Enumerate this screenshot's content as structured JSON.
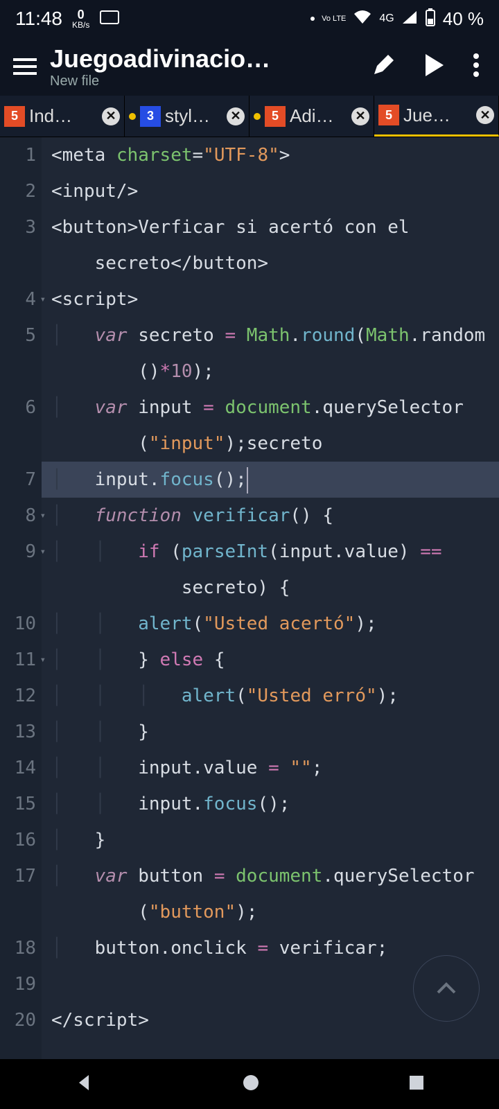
{
  "status": {
    "time": "11:48",
    "data_n": "0",
    "data_unit": "KB/s",
    "net": "4G",
    "battery": "40 %",
    "volte": "Vo LTE"
  },
  "toolbar": {
    "title": "Juegoadivinacio…",
    "subtitle": "New file"
  },
  "tabs": [
    {
      "type": "html",
      "badge": "5",
      "label": "Ind…",
      "modified": false
    },
    {
      "type": "css",
      "badge": "3",
      "label": "styl…",
      "modified": true
    },
    {
      "type": "html",
      "badge": "5",
      "label": "Adi…",
      "modified": true
    },
    {
      "type": "html",
      "badge": "5",
      "label": "Jue…",
      "modified": false,
      "active": true
    }
  ],
  "code_lines": [
    {
      "n": 1,
      "html": "<span class='t-tag'>&lt;meta</span> <span class='t-attr'>charset</span><span class='t-tag'>=</span><span class='t-str'>\"UTF-8\"</span><span class='t-tag'>&gt;</span>"
    },
    {
      "n": 2,
      "html": "<span class='t-tag'>&lt;input/&gt;</span>"
    },
    {
      "n": 3,
      "wrap": true,
      "html": "<span class='t-tag'>&lt;button&gt;</span>Verficar si acertó con el\n    secreto<span class='t-tag'>&lt;/button&gt;</span>"
    },
    {
      "n": 4,
      "fold": true,
      "html": "<span class='t-tag'>&lt;script&gt;</span>"
    },
    {
      "n": 5,
      "wrap": true,
      "html": "<span class='guide'>│   </span><span class='t-kw'>var</span> secreto <span class='t-op'>=</span> <span class='t-obj'>Math</span>.<span class='t-fn'>round</span>(<span class='t-obj'>Math</span>.random\n        ()<span class='t-op'>*</span><span class='t-num'>10</span>);"
    },
    {
      "n": 6,
      "wrap": true,
      "html": "<span class='guide'>│   </span><span class='t-kw'>var</span> input <span class='t-op'>=</span> <span class='t-obj'>document</span>.querySelector\n        (<span class='t-str'>\"input\"</span>);secreto"
    },
    {
      "n": 7,
      "hl": true,
      "html": "<span class='guide'>│   </span>input.<span class='t-fn'>focus</span>();<span class='cursor'></span>"
    },
    {
      "n": 8,
      "fold": true,
      "html": "<span class='guide'>│   </span><span class='t-kw'>function</span> <span class='t-name'>verificar</span>() {"
    },
    {
      "n": 9,
      "fold": true,
      "wrap": true,
      "html": "<span class='guide'>│   │   </span><span class='t-kw2'>if</span> (<span class='t-fn'>parseInt</span>(input.value) <span class='t-op'>==</span>\n            secreto) {"
    },
    {
      "n": 10,
      "html": "<span class='guide'>│   │   </span><span class='t-fn'>alert</span>(<span class='t-str'>\"Usted acertó\"</span>);"
    },
    {
      "n": 11,
      "fold": true,
      "html": "<span class='guide'>│   │   </span>} <span class='t-kw2'>else</span> {"
    },
    {
      "n": 12,
      "html": "<span class='guide'>│   │   │   </span><span class='t-fn'>alert</span>(<span class='t-str'>\"Usted erró\"</span>);"
    },
    {
      "n": 13,
      "html": "<span class='guide'>│   │   </span>}"
    },
    {
      "n": 14,
      "html": "<span class='guide'>│   │   </span>input.value <span class='t-op'>=</span> <span class='t-str'>\"\"</span>;"
    },
    {
      "n": 15,
      "html": "<span class='guide'>│   │   </span>input.<span class='t-fn'>focus</span>();"
    },
    {
      "n": 16,
      "html": "<span class='guide'>│   </span>}"
    },
    {
      "n": 17,
      "wrap": true,
      "html": "<span class='guide'>│   </span><span class='t-kw'>var</span> button <span class='t-op'>=</span> <span class='t-obj'>document</span>.querySelector\n        (<span class='t-str'>\"button\"</span>);"
    },
    {
      "n": 18,
      "html": "<span class='guide'>│   </span>button.onclick <span class='t-op'>=</span> verificar;"
    },
    {
      "n": 19,
      "html": ""
    },
    {
      "n": 20,
      "html": "<span class='t-tag'>&lt;/script&gt;</span>"
    }
  ]
}
